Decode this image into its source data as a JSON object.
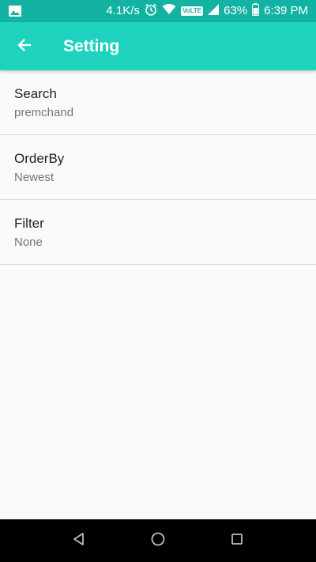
{
  "status_bar": {
    "speed": "4.1K/s",
    "volte": "VoLTE",
    "battery": "63%",
    "time": "6:39 PM"
  },
  "app_bar": {
    "title": "Setting",
    "back_icon": "arrow-back-icon"
  },
  "preferences": [
    {
      "title": "Search",
      "summary": "premchand"
    },
    {
      "title": "OrderBy",
      "summary": "Newest"
    },
    {
      "title": "Filter",
      "summary": "None"
    }
  ],
  "colors": {
    "status_bar": "#13b3a3",
    "app_bar": "#1fd2be",
    "background": "#fafafa",
    "nav_bar": "#000000"
  },
  "nav_bar": {
    "icons": [
      "back-triangle-icon",
      "home-circle-icon",
      "recents-square-icon"
    ]
  }
}
